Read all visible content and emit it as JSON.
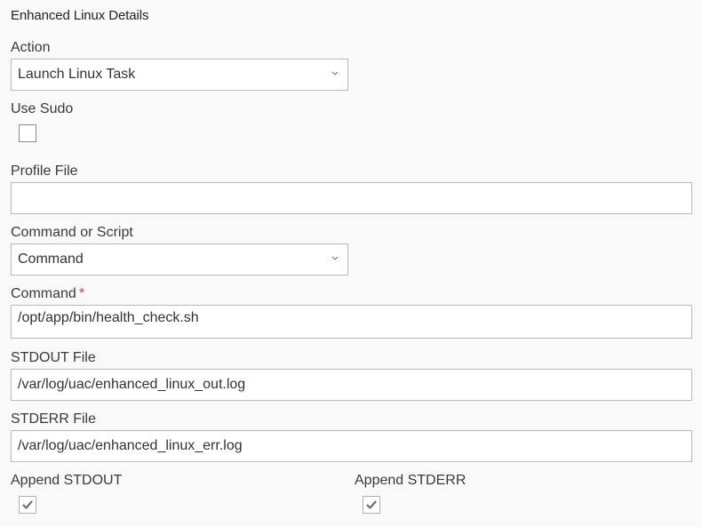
{
  "section": {
    "title": "Enhanced Linux Details"
  },
  "action": {
    "label": "Action",
    "value": "Launch Linux Task"
  },
  "use_sudo": {
    "label": "Use Sudo",
    "checked": false
  },
  "profile_file": {
    "label": "Profile File",
    "value": ""
  },
  "command_or_script": {
    "label": "Command or Script",
    "value": "Command"
  },
  "command": {
    "label": "Command",
    "required_marker": "*",
    "value": "/opt/app/bin/health_check.sh"
  },
  "stdout_file": {
    "label": "STDOUT File",
    "value": "/var/log/uac/enhanced_linux_out.log"
  },
  "stderr_file": {
    "label": "STDERR File",
    "value": "/var/log/uac/enhanced_linux_err.log"
  },
  "append_stdout": {
    "label": "Append STDOUT",
    "checked": true
  },
  "append_stderr": {
    "label": "Append STDERR",
    "checked": true
  },
  "icons": {
    "dropdown": "chevron-down-icon",
    "check": "check-icon"
  },
  "colors": {
    "background": "#f9f9f9",
    "required": "#d63b3b",
    "border": "#b9b9b9"
  }
}
